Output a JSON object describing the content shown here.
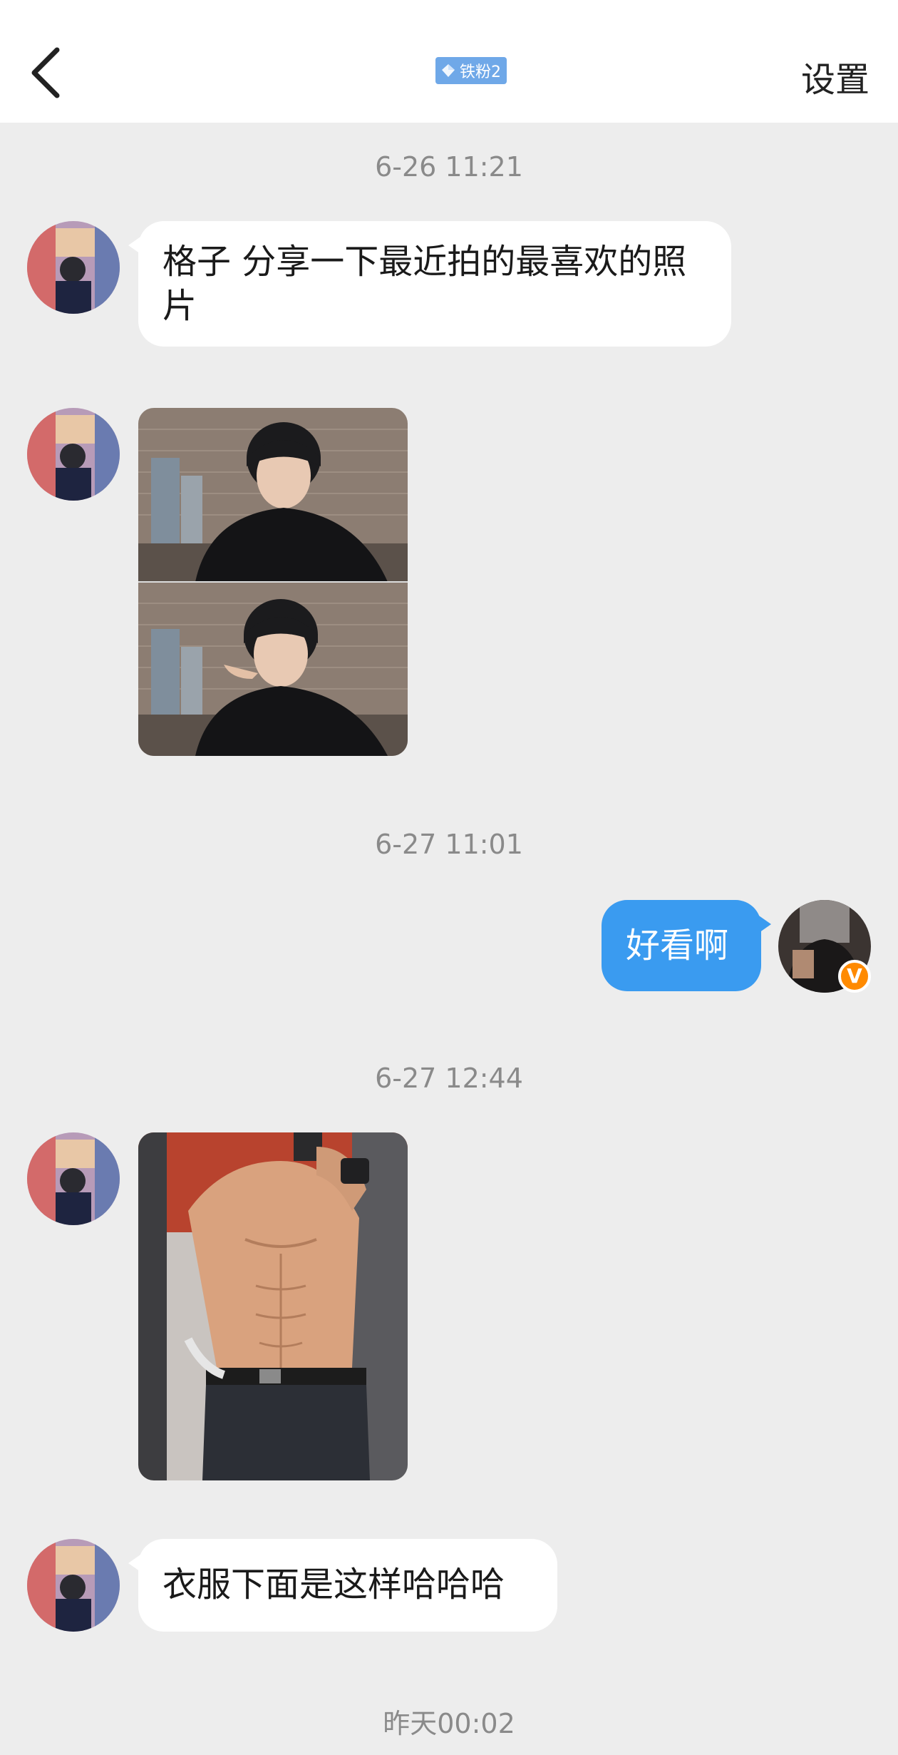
{
  "header": {
    "fan_badge": "铁粉2",
    "settings_label": "设置",
    "back_icon": "chevron-left-icon"
  },
  "colors": {
    "header_bg": "#ffffff",
    "chat_bg": "#ededed",
    "incoming_bubble": "#ffffff",
    "outgoing_bubble": "#3a9bf0",
    "fan_badge": "#6fa8e8",
    "verified_badge": "#ff8a00"
  },
  "messages": [
    {
      "type": "timestamp",
      "text": "6-26 11:21"
    },
    {
      "type": "text",
      "side": "left",
      "text": "格子 分享一下最近拍的最喜欢的照片"
    },
    {
      "type": "image",
      "side": "left",
      "content": "two stacked photos of a young man in a black t-shirt sitting by a brick wall"
    },
    {
      "type": "timestamp",
      "text": "6-27 11:01"
    },
    {
      "type": "text",
      "side": "right",
      "text": "好看啊"
    },
    {
      "type": "timestamp",
      "text": "6-27 12:44"
    },
    {
      "type": "image",
      "side": "left",
      "content": "mirror selfie of a shirtless man in a gym"
    },
    {
      "type": "text",
      "side": "left",
      "text": "衣服下面是这样哈哈哈"
    },
    {
      "type": "timestamp",
      "text": "昨天00:02"
    }
  ],
  "verified_badge_label": "V"
}
